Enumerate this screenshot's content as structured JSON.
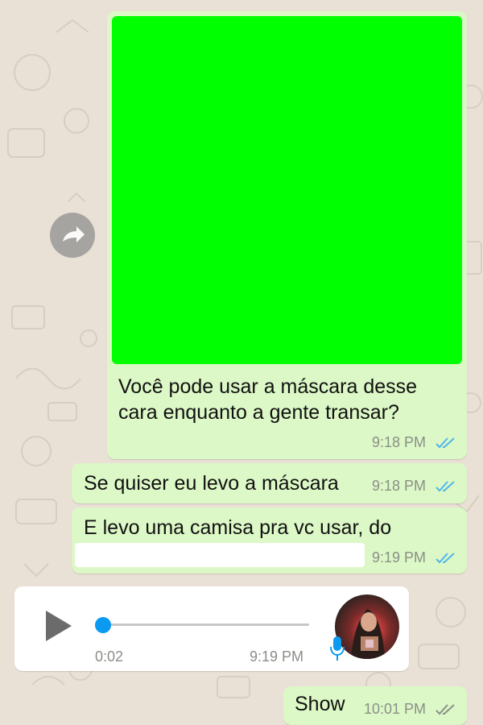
{
  "colors": {
    "chat_background": "#e9e1d6",
    "outgoing_bubble": "#dcf8c6",
    "incoming_bubble": "#ffffff",
    "read_tick_blue": "#4fb6ec",
    "delivered_tick_grey": "#8a8f88",
    "media_placeholder": "#00ff00",
    "audio_accent": "#0a9af2"
  },
  "messages": [
    {
      "text_line1": "Você pode usar a máscara desse",
      "text_line2": "cara enquanto a gente transar?",
      "time": "9:18 PM",
      "status": "read",
      "has_media": true
    },
    {
      "text": "Se quiser eu levo a máscara",
      "time": "9:18 PM",
      "status": "read"
    },
    {
      "text": "E levo uma camisa pra vc usar, do",
      "time": "9:19 PM",
      "status": "read"
    },
    {
      "type": "voice",
      "duration": "0:02",
      "time": "9:19 PM",
      "progress": 0.0
    },
    {
      "text": "Show",
      "time": "10:01 PM",
      "status": "delivered"
    }
  ],
  "icons": {
    "forward": "forward-arrow-icon",
    "play": "play-icon",
    "mic": "microphone-icon",
    "read": "double-check-icon"
  }
}
